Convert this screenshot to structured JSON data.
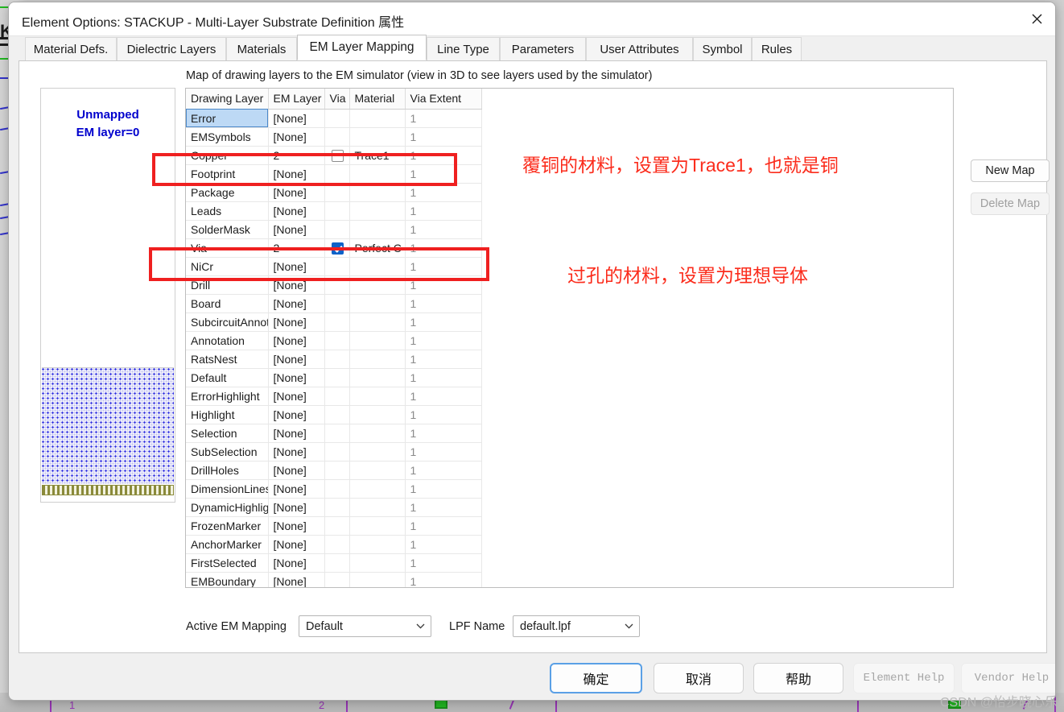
{
  "window": {
    "title": "Element Options: STACKUP - Multi-Layer Substrate Definition 属性",
    "close_icon": "close-icon"
  },
  "tabs": [
    {
      "label": "Material Defs.",
      "active": false
    },
    {
      "label": "Dielectric Layers",
      "active": false
    },
    {
      "label": "Materials",
      "active": false
    },
    {
      "label": "EM Layer Mapping",
      "active": true
    },
    {
      "label": "Line Type",
      "active": false
    },
    {
      "label": "Parameters",
      "active": false
    },
    {
      "label": "User Attributes",
      "active": false
    },
    {
      "label": "Symbol",
      "active": false
    },
    {
      "label": "Rules",
      "active": false
    }
  ],
  "panel": {
    "caption": "Map of drawing layers to the EM simulator (view in 3D to see layers used by the simulator)",
    "preview": {
      "line1": "Unmapped",
      "line2": "EM layer=0",
      "label_color": "#0000cd"
    },
    "table": {
      "columns": [
        "Drawing Layer",
        "EM Layer",
        "Via",
        "Material",
        "Via Extent"
      ],
      "rows": [
        {
          "layer": "Error",
          "em": "[None]",
          "via": "none",
          "material": "",
          "extent": "1",
          "selected": true
        },
        {
          "layer": "EMSymbols",
          "em": "[None]",
          "via": "none",
          "material": "",
          "extent": "1",
          "selected": false
        },
        {
          "layer": "Copper",
          "em": "2",
          "via": "unchecked",
          "material": "Trace1",
          "extent": "1",
          "selected": false
        },
        {
          "layer": "Footprint",
          "em": "[None]",
          "via": "none",
          "material": "",
          "extent": "1",
          "selected": false
        },
        {
          "layer": "Package",
          "em": "[None]",
          "via": "none",
          "material": "",
          "extent": "1",
          "selected": false
        },
        {
          "layer": "Leads",
          "em": "[None]",
          "via": "none",
          "material": "",
          "extent": "1",
          "selected": false
        },
        {
          "layer": "SolderMask",
          "em": "[None]",
          "via": "none",
          "material": "",
          "extent": "1",
          "selected": false
        },
        {
          "layer": "Via",
          "em": "2",
          "via": "checked",
          "material": "Perfect C",
          "extent": "1",
          "selected": false
        },
        {
          "layer": "NiCr",
          "em": "[None]",
          "via": "none",
          "material": "",
          "extent": "1",
          "selected": false
        },
        {
          "layer": "Drill",
          "em": "[None]",
          "via": "none",
          "material": "",
          "extent": "1",
          "selected": false
        },
        {
          "layer": "Board",
          "em": "[None]",
          "via": "none",
          "material": "",
          "extent": "1",
          "selected": false
        },
        {
          "layer": "SubcircuitAnnot",
          "em": "[None]",
          "via": "none",
          "material": "",
          "extent": "1",
          "selected": false
        },
        {
          "layer": "Annotation",
          "em": "[None]",
          "via": "none",
          "material": "",
          "extent": "1",
          "selected": false
        },
        {
          "layer": "RatsNest",
          "em": "[None]",
          "via": "none",
          "material": "",
          "extent": "1",
          "selected": false
        },
        {
          "layer": "Default",
          "em": "[None]",
          "via": "none",
          "material": "",
          "extent": "1",
          "selected": false
        },
        {
          "layer": "ErrorHighlight",
          "em": "[None]",
          "via": "none",
          "material": "",
          "extent": "1",
          "selected": false
        },
        {
          "layer": "Highlight",
          "em": "[None]",
          "via": "none",
          "material": "",
          "extent": "1",
          "selected": false
        },
        {
          "layer": "Selection",
          "em": "[None]",
          "via": "none",
          "material": "",
          "extent": "1",
          "selected": false
        },
        {
          "layer": "SubSelection",
          "em": "[None]",
          "via": "none",
          "material": "",
          "extent": "1",
          "selected": false
        },
        {
          "layer": "DrillHoles",
          "em": "[None]",
          "via": "none",
          "material": "",
          "extent": "1",
          "selected": false
        },
        {
          "layer": "DimensionLines",
          "em": "[None]",
          "via": "none",
          "material": "",
          "extent": "1",
          "selected": false
        },
        {
          "layer": "DynamicHighligh",
          "em": "[None]",
          "via": "none",
          "material": "",
          "extent": "1",
          "selected": false
        },
        {
          "layer": "FrozenMarker",
          "em": "[None]",
          "via": "none",
          "material": "",
          "extent": "1",
          "selected": false
        },
        {
          "layer": "AnchorMarker",
          "em": "[None]",
          "via": "none",
          "material": "",
          "extent": "1",
          "selected": false
        },
        {
          "layer": "FirstSelected",
          "em": "[None]",
          "via": "none",
          "material": "",
          "extent": "1",
          "selected": false
        },
        {
          "layer": "EMBoundary",
          "em": "[None]",
          "via": "none",
          "material": "",
          "extent": "1",
          "selected": false
        }
      ]
    },
    "side_buttons": {
      "new_map": "New Map",
      "delete_map": "Delete Map"
    },
    "active_mapping": {
      "label": "Active EM Mapping",
      "value": "Default"
    },
    "lpf": {
      "label": "LPF Name",
      "value": "default.lpf"
    }
  },
  "footer": {
    "ok": "确定",
    "cancel": "取消",
    "help": "帮助",
    "element_help": "Element Help",
    "vendor_help": "Vendor Help"
  },
  "annotations": {
    "copper_note": "覆铜的材料，设置为Trace1，也就是铜",
    "via_note": "过孔的材料，设置为理想导体",
    "color": "#fb2c1c"
  },
  "watermark": "CSDN @怡步晓心乐"
}
